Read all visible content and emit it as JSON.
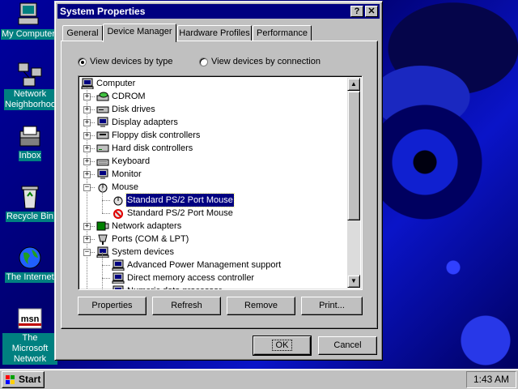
{
  "desktop": {
    "icons": [
      {
        "label": "My Computer",
        "icon": "computer-icon"
      },
      {
        "label": "Network Neighborhood",
        "icon": "network-icon"
      },
      {
        "label": "Inbox",
        "icon": "inbox-icon"
      },
      {
        "label": "Recycle Bin",
        "icon": "recycle-bin-icon"
      },
      {
        "label": "The Internet",
        "icon": "globe-icon"
      },
      {
        "label": "The Microsoft Network",
        "icon": "msn-icon"
      }
    ]
  },
  "dialog": {
    "title": "System Properties",
    "help_button": "?",
    "close_button": "✕",
    "tabs": [
      {
        "label": "General",
        "active": false
      },
      {
        "label": "Device Manager",
        "active": true
      },
      {
        "label": "Hardware Profiles",
        "active": false
      },
      {
        "label": "Performance",
        "active": false
      }
    ],
    "view_options": [
      {
        "label": "View devices by type",
        "selected": true
      },
      {
        "label": "View devices by connection",
        "selected": false
      }
    ],
    "tree": {
      "root": "Computer",
      "items": [
        {
          "label": "CDROM",
          "level": 1,
          "expander": "+",
          "icon": "cdrom-icon"
        },
        {
          "label": "Disk drives",
          "level": 1,
          "expander": "+",
          "icon": "disk-drive-icon"
        },
        {
          "label": "Display adapters",
          "level": 1,
          "expander": "+",
          "icon": "display-adapter-icon"
        },
        {
          "label": "Floppy disk controllers",
          "level": 1,
          "expander": "+",
          "icon": "floppy-controller-icon"
        },
        {
          "label": "Hard disk controllers",
          "level": 1,
          "expander": "+",
          "icon": "hard-disk-controller-icon"
        },
        {
          "label": "Keyboard",
          "level": 1,
          "expander": "+",
          "icon": "keyboard-icon"
        },
        {
          "label": "Monitor",
          "level": 1,
          "expander": "+",
          "icon": "monitor-icon"
        },
        {
          "label": "Mouse",
          "level": 1,
          "expander": "−",
          "icon": "mouse-icon"
        },
        {
          "label": "Standard PS/2 Port Mouse",
          "level": 2,
          "expander": "",
          "icon": "mouse-icon",
          "selected": true
        },
        {
          "label": "Standard PS/2 Port Mouse",
          "level": 2,
          "expander": "",
          "icon": "mouse-disabled-icon"
        },
        {
          "label": "Network adapters",
          "level": 1,
          "expander": "+",
          "icon": "network-adapter-icon"
        },
        {
          "label": "Ports (COM & LPT)",
          "level": 1,
          "expander": "+",
          "icon": "port-icon"
        },
        {
          "label": "System devices",
          "level": 1,
          "expander": "−",
          "icon": "system-device-icon"
        },
        {
          "label": "Advanced Power Management support",
          "level": 2,
          "expander": "",
          "icon": "system-device-icon"
        },
        {
          "label": "Direct memory access controller",
          "level": 2,
          "expander": "",
          "icon": "system-device-icon"
        },
        {
          "label": "Numeric data processor",
          "level": 2,
          "expander": "",
          "icon": "system-device-icon"
        }
      ]
    },
    "buttons": {
      "properties": "Properties",
      "refresh": "Refresh",
      "remove": "Remove",
      "print": "Print...",
      "ok": "OK",
      "cancel": "Cancel"
    }
  },
  "taskbar": {
    "start_label": "Start",
    "clock": "1:43 AM"
  },
  "colors": {
    "titlebar": "#000080",
    "face": "#c0c0c0",
    "desktop_label_bg": "#008080",
    "selection": "#000080"
  }
}
